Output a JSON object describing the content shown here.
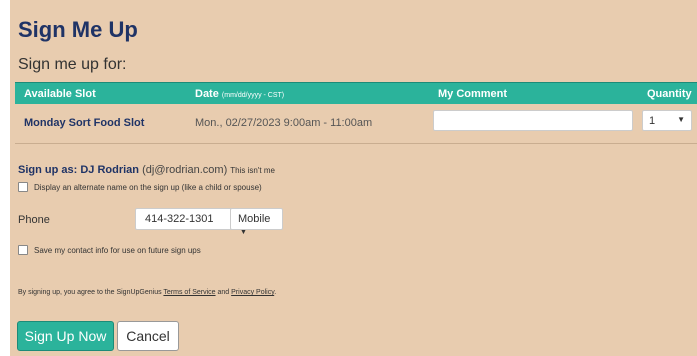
{
  "page": {
    "title": "Sign Me Up",
    "subtitle": "Sign me up for:"
  },
  "table": {
    "headers": {
      "slot": "Available Slot",
      "date": "Date",
      "date_hint": "(mm/dd/yyyy - CST)",
      "comment": "My Comment",
      "quantity": "Quantity"
    },
    "rows": [
      {
        "slot": "Monday Sort Food Slot",
        "date": "Mon., 02/27/2023 9:00am - 11:00am",
        "comment": "",
        "quantity": "1"
      }
    ]
  },
  "signup_as": {
    "label": "Sign up as:",
    "name": "DJ Rodrian",
    "email": "(dj@rodrian.com)",
    "not_me": "This isn't me"
  },
  "alt_name": {
    "label": "Display an alternate name on the sign up (like a child or spouse)",
    "checked": false
  },
  "phone": {
    "label": "Phone",
    "value": "414-322-1301",
    "type": "Mobile"
  },
  "save_contact": {
    "label": "Save my contact info for use on future sign ups",
    "checked": false
  },
  "terms": {
    "prefix": "By signing up, you agree to the SignUpGenius",
    "tos": "Terms of Service",
    "and": "and",
    "privacy": "Privacy Policy",
    "suffix": "."
  },
  "buttons": {
    "submit": "Sign Up Now",
    "cancel": "Cancel"
  },
  "colors": {
    "background": "#e8ccaf",
    "accent": "#2bb39b",
    "title": "#1f3366"
  }
}
